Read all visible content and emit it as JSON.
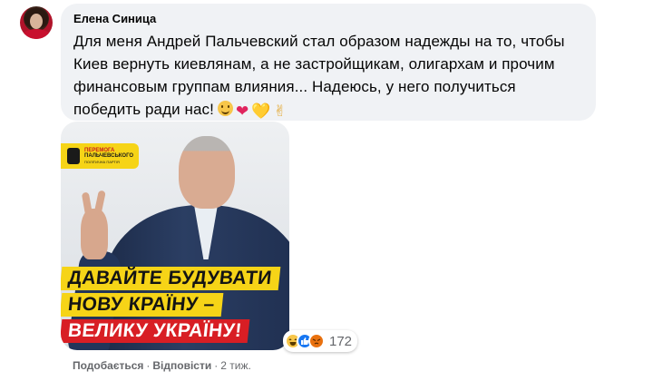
{
  "comment": {
    "author": "Елена Синица",
    "text_lines": [
      "Для меня Андрей Пальчевский стал образом надежды на то, чтобы",
      "Киев вернуть киевлянам, а не застройщикам, олигархам и прочим",
      "финансовым группам влияния... Надеюсь, у него получиться",
      "победить ради нас!"
    ],
    "emojis": [
      "slightly-smiling-face-icon",
      "red-heart-icon",
      "yellow-heart-icon",
      "victory-hand-icon"
    ],
    "emoji_glyphs": {
      "heart_red": "❤",
      "heart_yellow": "💛",
      "victory": "✌"
    }
  },
  "image": {
    "logo_lines": [
      "ПЕРЕМОГА",
      "ПАЛЬЧЕВСЬКОГО",
      "ПОЛІТИЧНА ПАРТІЯ"
    ],
    "slogan": [
      "ДАВАЙТЕ БУДУВАТИ",
      "НОВУ КРАЇНУ –",
      "ВЕЛИКУ УКРАЇНУ!"
    ],
    "colors": {
      "brand_yellow": "#f6d417",
      "brand_red": "#d81e24",
      "suit": "#22355a"
    }
  },
  "reactions": {
    "types": [
      "haha-icon",
      "like-icon",
      "angry-icon"
    ],
    "count": "172"
  },
  "actions": {
    "like": "Подобається",
    "separator": "·",
    "reply": "Відповісти",
    "time": "2 тиж."
  }
}
